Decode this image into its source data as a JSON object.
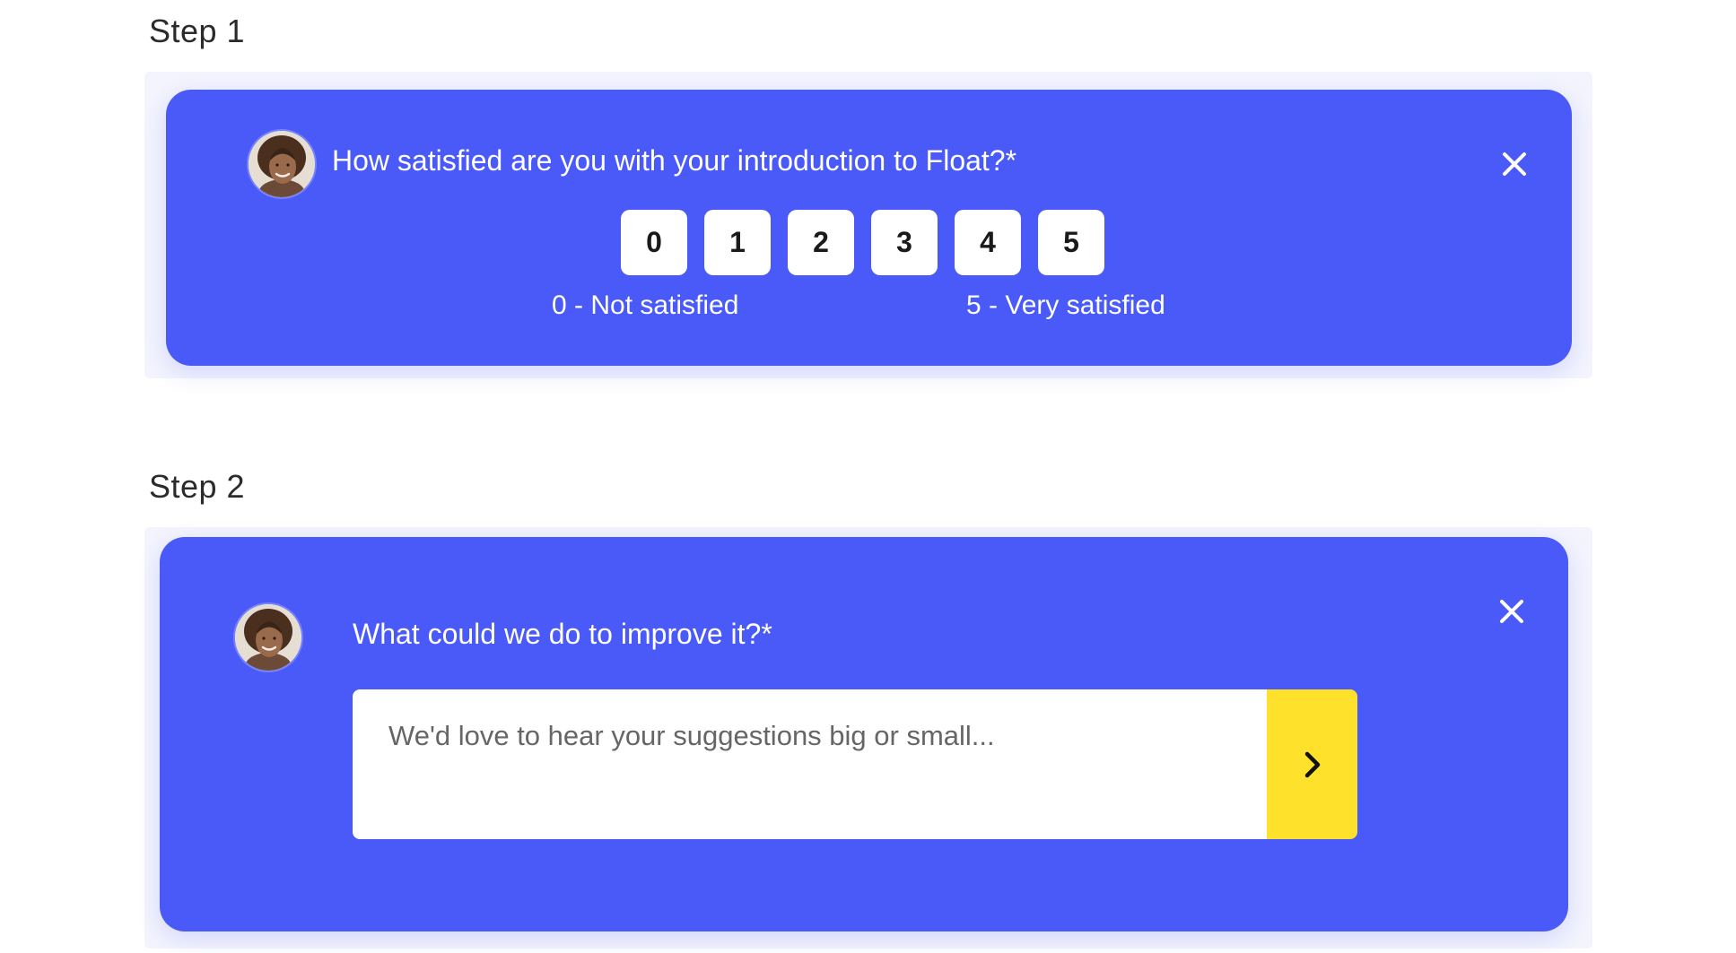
{
  "steps": [
    {
      "label": "Step 1",
      "question": "How satisfied are you with your introduction to Float?*",
      "scale": [
        "0",
        "1",
        "2",
        "3",
        "4",
        "5"
      ],
      "low_caption": "0 - Not satisfied",
      "high_caption": "5 - Very satisfied"
    },
    {
      "label": "Step 2",
      "question": "What could we do to improve it?*",
      "input": {
        "value": "",
        "placeholder": "We'd love to hear your suggestions big or small..."
      }
    }
  ],
  "icons": {
    "close": "close-icon",
    "submit": "chevron-right-icon",
    "avatar": "avatar-photo"
  },
  "colors": {
    "card": "#4a5af8",
    "frame": "#f3f4fd",
    "submit": "#fde12b",
    "text_on_card": "#ffffff"
  }
}
